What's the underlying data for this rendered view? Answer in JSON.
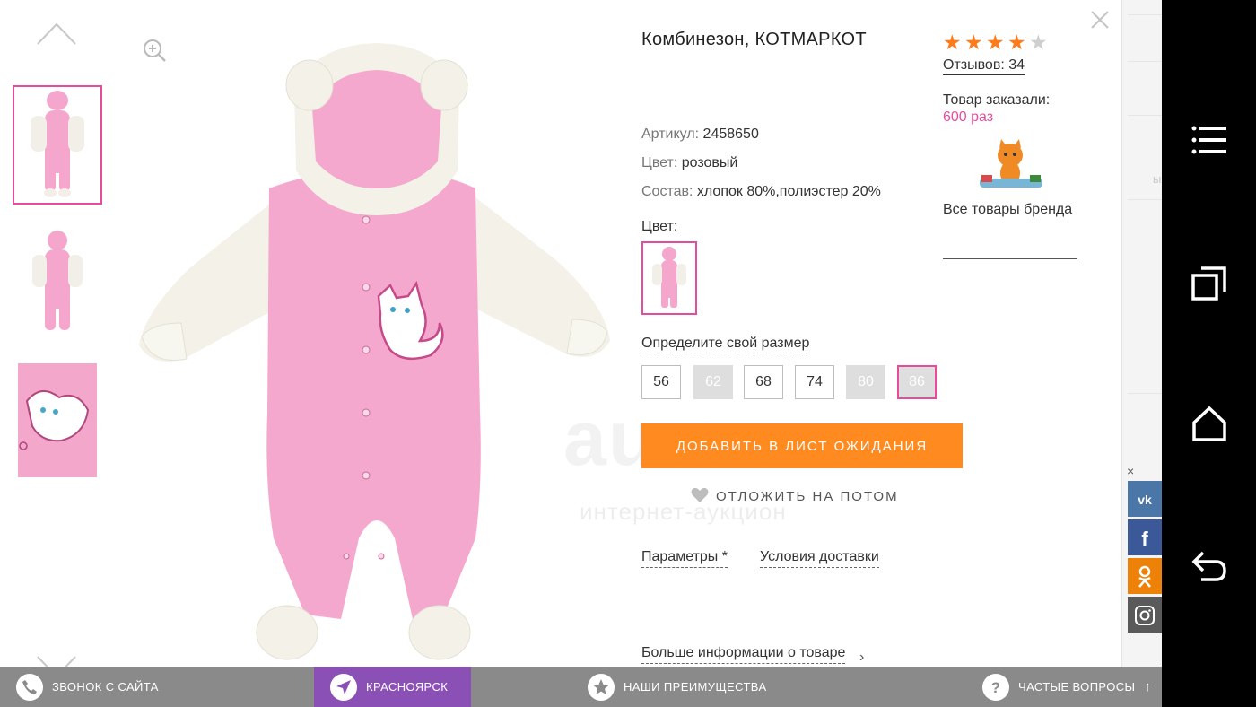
{
  "product": {
    "title": "Комбинезон, КОТМАРКОТ",
    "article_key": "Артикул:",
    "article_val": "2458650",
    "color_key": "Цвет:",
    "color_val": "розовый",
    "composition_key": "Состав:",
    "composition_val": "хлопок 80%,полиэстер 20%",
    "color_label": "Цвет:",
    "size_label": "Определите свой размер",
    "sizes": [
      {
        "label": "56",
        "state": "available"
      },
      {
        "label": "62",
        "state": "unavailable"
      },
      {
        "label": "68",
        "state": "available"
      },
      {
        "label": "74",
        "state": "available"
      },
      {
        "label": "80",
        "state": "unavailable"
      },
      {
        "label": "86",
        "state": "selected-unavailable"
      }
    ],
    "waitlist_button": "ДОБАВИТЬ В ЛИСТ ОЖИДАНИЯ",
    "later_link": "ОТЛОЖИТЬ НА ПОТОМ",
    "tab_params": "Параметры *",
    "tab_delivery": "Условия доставки",
    "more_info": "Больше информации о товаре",
    "more_arrow": "›"
  },
  "rating": {
    "stars": 4,
    "max_stars": 5,
    "reviews": "Отзывов: 34",
    "ordered_label": "Товар заказали:",
    "ordered_value": "600 раз",
    "brand_all": "Все товары бренда"
  },
  "watermark": {
    "big": "au.ru",
    "small": "интернет-аукцион"
  },
  "behind": {
    "ghost": "ы"
  },
  "social": {
    "close": "×",
    "items": [
      {
        "name": "vk",
        "label": "vk",
        "color": "#4a76a8"
      },
      {
        "name": "facebook",
        "label": "f",
        "color": "#3b5998"
      },
      {
        "name": "odnoklassniki",
        "label": "ок",
        "color": "#ee8208"
      },
      {
        "name": "instagram",
        "label": "ig",
        "color": "#555555"
      }
    ]
  },
  "bottombar": {
    "call": "ЗВОНОК С САЙТА",
    "city": "КРАСНОЯРСК",
    "advantages": "НАШИ ПРЕИМУЩЕСТВА",
    "faq": "ЧАСТЫЕ ВОПРОСЫ",
    "faq_arrow": "↑"
  },
  "colors": {
    "accent_pink": "#e74c9c",
    "orange": "#ff8a1f",
    "purple": "#8b50b5",
    "bar_gray": "#8a8a8a",
    "star": "#ff7a1a"
  }
}
